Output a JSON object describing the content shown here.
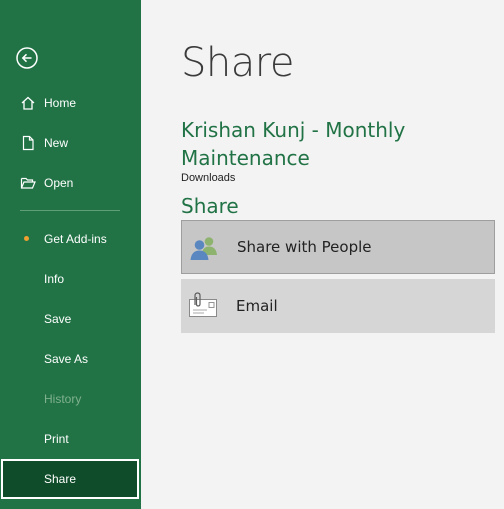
{
  "sidebar": {
    "back_label": "Back",
    "items": [
      {
        "label": "Home",
        "icon": "home-icon"
      },
      {
        "label": "New",
        "icon": "new-document-icon"
      },
      {
        "label": "Open",
        "icon": "open-folder-icon"
      },
      {
        "label": "Get Add-ins"
      },
      {
        "label": "Info"
      },
      {
        "label": "Save"
      },
      {
        "label": "Save As"
      },
      {
        "label": "History",
        "disabled": true
      },
      {
        "label": "Print"
      },
      {
        "label": "Share",
        "active": true
      }
    ]
  },
  "main": {
    "title": "Share",
    "document_title": "Krishan Kunj - Monthly Maintenance",
    "document_location": "Downloads",
    "section_heading": "Share",
    "options": [
      {
        "label": "Share with People",
        "icon": "share-with-people-icon",
        "selected": true
      },
      {
        "label": "Email",
        "icon": "email-icon",
        "selected": false
      }
    ]
  },
  "colors": {
    "sidebar_bg": "#217346",
    "accent_text": "#217346",
    "active_item_bg": "#0f4d2a",
    "notification_dot": "#f0a030"
  }
}
